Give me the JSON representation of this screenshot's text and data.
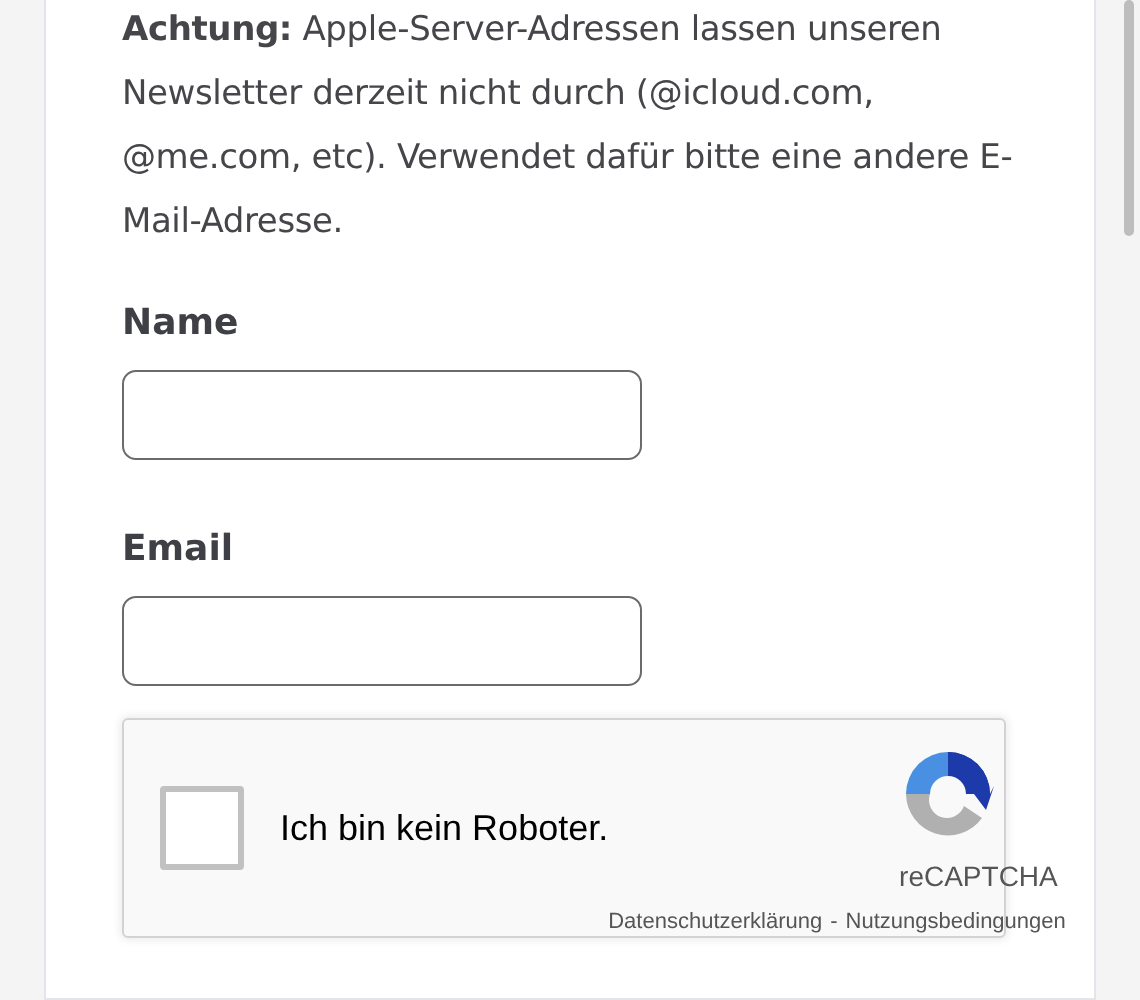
{
  "notice": "**Achtung:** Apple-Server-Adressen lassen unseren Newsletter derzeit nicht durch (@icloud.com, @me.com, etc). Verwendet dafür bitte eine andere E-Mail-Adresse.",
  "fields": [
    {
      "label": "Name"
    },
    {
      "label": "Email"
    }
  ],
  "captcha": {
    "label": "Ich bin kein Roboter.",
    "checked": false,
    "brand": "reCAPTCHA",
    "privacy": "Datenschutzerklärung",
    "separator": "-",
    "terms": "Nutzungsbedingungen"
  }
}
